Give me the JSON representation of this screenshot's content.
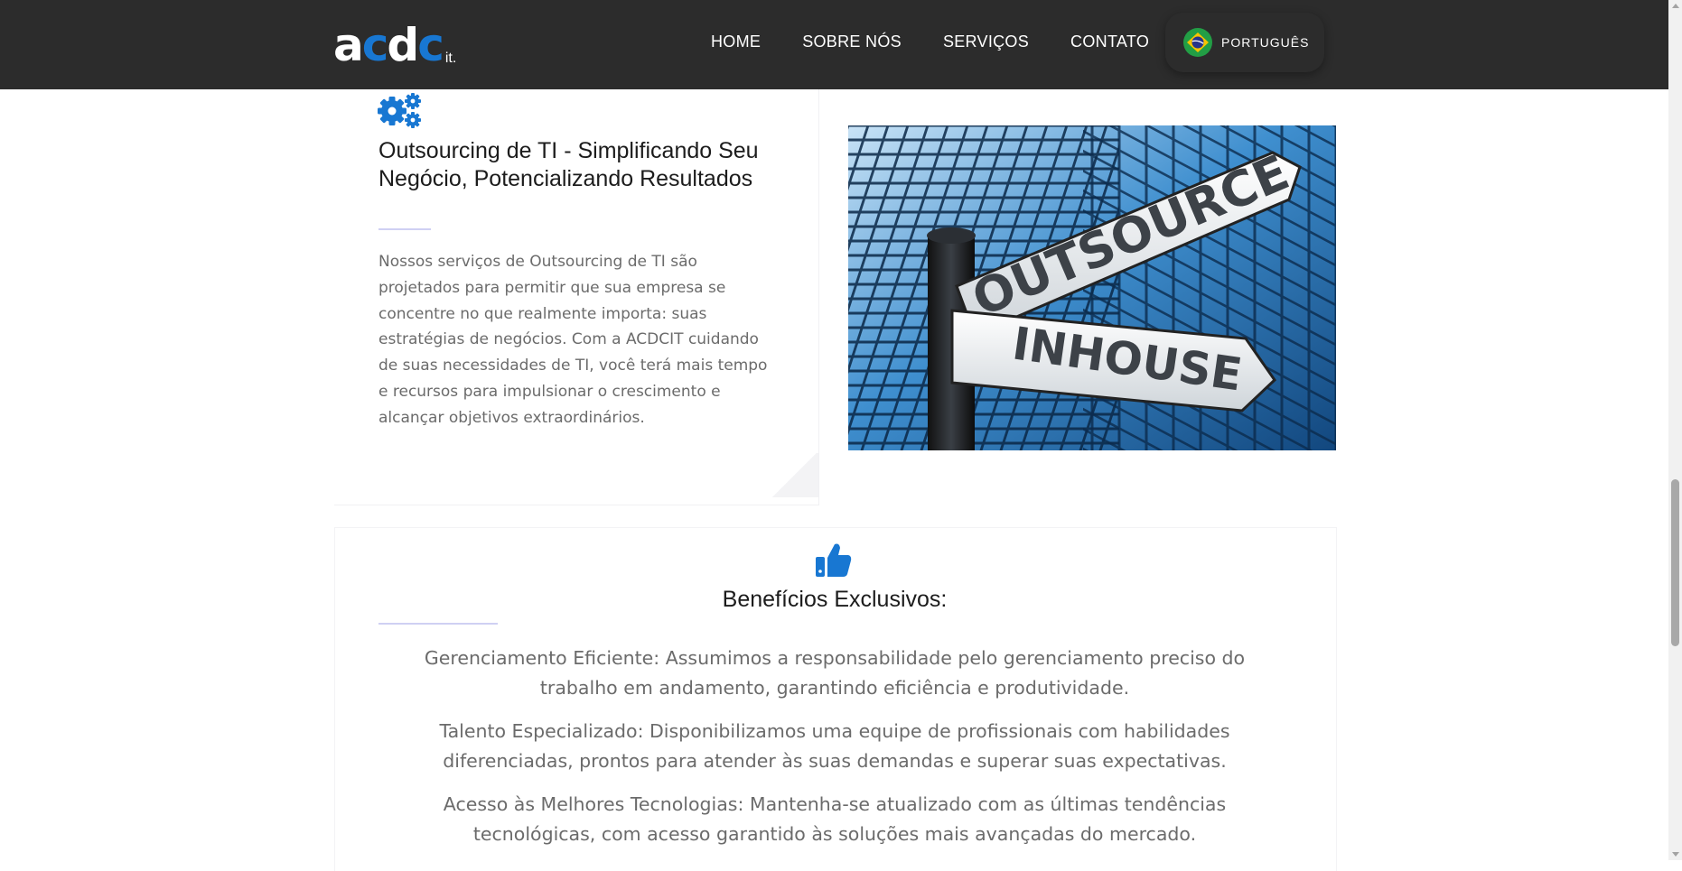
{
  "header": {
    "logo_main": "acdc",
    "logo_sub": "it.",
    "nav": [
      "HOME",
      "SOBRE NÓS",
      "SERVIÇOS",
      "CONTATO"
    ],
    "language": "PORTUGUÊS"
  },
  "outsourcing": {
    "icon": "gears-icon",
    "title": "Outsourcing de TI - Simplificando Seu Negócio, Potencializando Resultados",
    "description": "Nossos serviços de Outsourcing de TI são projetados para permitir que sua empresa se concentre no que realmente importa: suas estratégias de negócios. Com a ACDCIT cuidando de suas necessidades de TI, você terá mais tempo e recursos para impulsionar o crescimento e alcançar objetivos extraordinários.",
    "image_sign_top": "OUTSOURCE",
    "image_sign_bottom": "INHOUSE"
  },
  "benefits": {
    "icon": "thumbs-up-icon",
    "title": "Benefícios Exclusivos:",
    "items": [
      "Gerenciamento Eficiente: Assumimos a responsabilidade pelo gerenciamento preciso do trabalho em andamento, garantindo eficiência e produtividade.",
      "Talento Especializado: Disponibilizamos uma equipe de profissionais com habilidades diferenciadas, prontos para atender às suas demandas e superar suas expectativas.",
      "Acesso às Melhores Tecnologias: Mantenha-se atualizado com as últimas tendências tecnológicas, com acesso garantido às soluções mais avançadas do mercado."
    ]
  },
  "colors": {
    "header_bg": "#2c2c2c",
    "accent_blue": "#1877d2",
    "text_dark": "#1c1c1c",
    "text_body": "#6b6b6b",
    "divider": "#cfd0f3"
  }
}
